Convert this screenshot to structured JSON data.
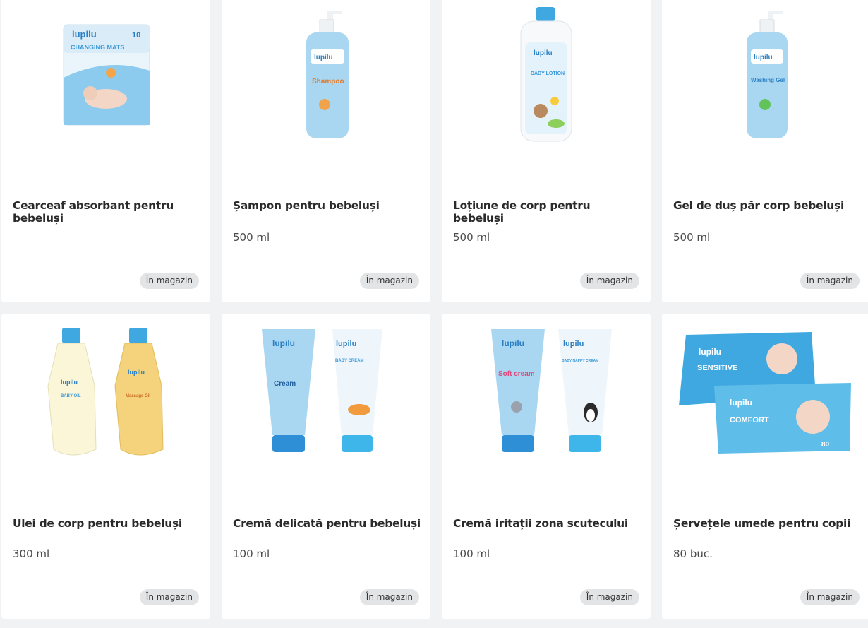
{
  "products": [
    {
      "title": "Cearceaf absorbant pentru bebeluși",
      "quantity": "",
      "badge": "În magazin",
      "package": {
        "brand": "lupilu",
        "label": "CHANGING MATS",
        "count": "10"
      }
    },
    {
      "title": "Șampon pentru bebeluși",
      "quantity": "500 ml",
      "badge": "În magazin",
      "package": {
        "brand": "lupilu",
        "label": "Shampoo"
      }
    },
    {
      "title": "Loțiune de corp pentru bebeluși",
      "quantity": "500 ml",
      "badge": "În magazin",
      "package": {
        "brand": "lupilu",
        "label": "BABY LOTION"
      }
    },
    {
      "title": "Gel de duș păr corp bebeluși",
      "quantity": "500 ml",
      "badge": "În magazin",
      "package": {
        "brand": "lupilu",
        "label": "Washing Gel"
      }
    },
    {
      "title": "Ulei de corp pentru bebeluși",
      "quantity": "300 ml",
      "badge": "În magazin",
      "package": {
        "brand": "lupilu",
        "label": "BABY OIL",
        "label2": "Massage Oil"
      }
    },
    {
      "title": "Cremă delicată pentru bebeluși",
      "quantity": "100 ml",
      "badge": "În magazin",
      "package": {
        "brand": "lupilu",
        "label": "Cream",
        "label2": "BABY CREAM"
      }
    },
    {
      "title": "Cremă iritații zona scutecului",
      "quantity": "100 ml",
      "badge": "În magazin",
      "package": {
        "brand": "lupilu",
        "label": "Soft cream",
        "label2": "BABY NAPPY CREAM"
      }
    },
    {
      "title": "Șervețele umede pentru copii",
      "quantity": "80 buc.",
      "badge": "În magazin",
      "package": {
        "brand": "lupilu",
        "label": "SENSITIVE",
        "label2": "COMFORT",
        "count": "80"
      }
    }
  ],
  "colors": {
    "card": "#ffffff",
    "page": "#f1f2f3",
    "badge": "#e3e4e5",
    "packaging_blue": "#7fc4ea",
    "cap_blue": "#3fa8e0"
  }
}
